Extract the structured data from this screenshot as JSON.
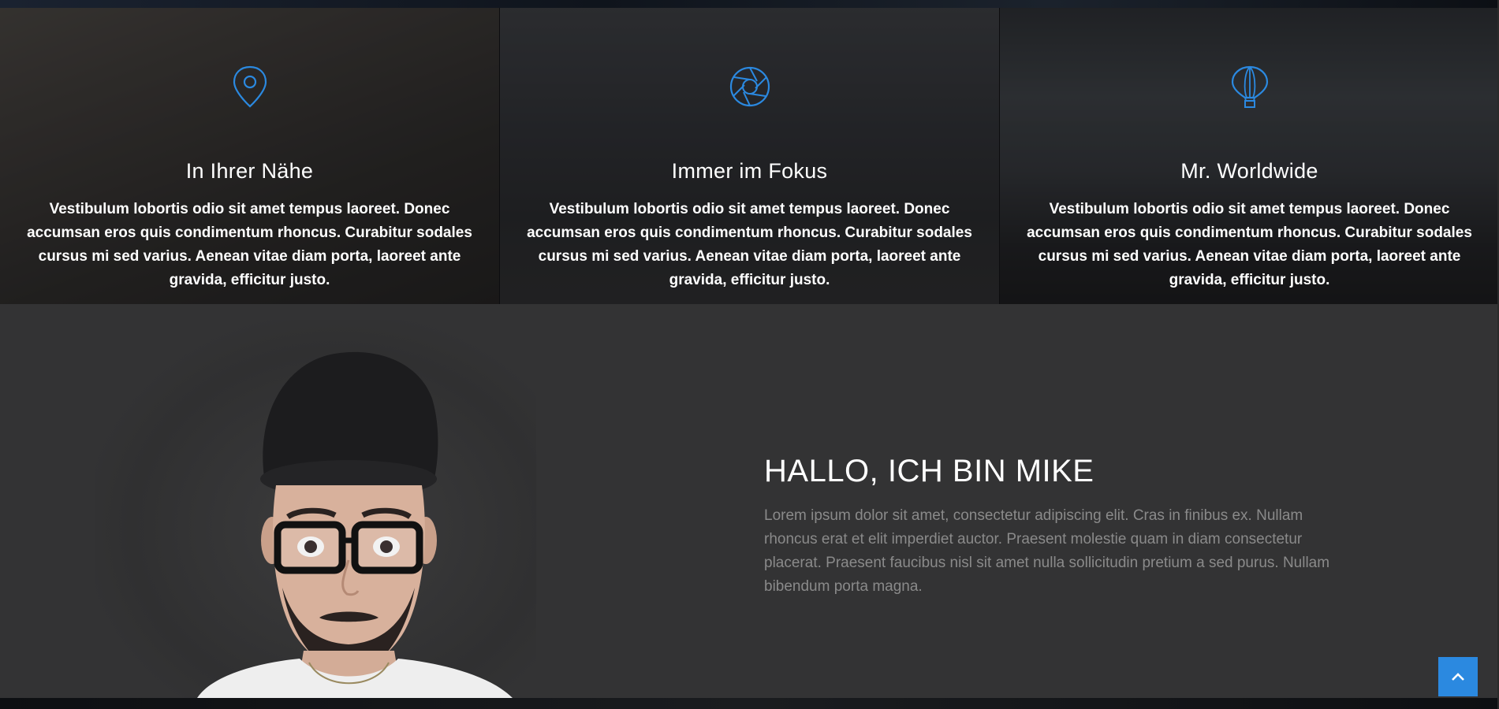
{
  "features": [
    {
      "icon": "map-pin-icon",
      "title": "In Ihrer Nähe",
      "text": "Vestibulum lobortis odio sit amet tempus laoreet. Donec accumsan eros quis condimentum rhoncus. Curabitur sodales cursus mi sed varius. Aenean vitae diam porta, laoreet ante gravida, efficitur justo."
    },
    {
      "icon": "camera-aperture-icon",
      "title": "Immer im Fokus",
      "text": "Vestibulum lobortis odio sit amet tempus laoreet. Donec accumsan eros quis condimentum rhoncus. Curabitur sodales cursus mi sed varius. Aenean vitae diam porta, laoreet ante gravida, efficitur justo."
    },
    {
      "icon": "hot-air-balloon-icon",
      "title": "Mr. Worldwide",
      "text": "Vestibulum lobortis odio sit amet tempus laoreet. Donec accumsan eros quis condimentum rhoncus. Curabitur sodales cursus mi sed varius. Aenean vitae diam porta, laoreet ante gravida, efficitur justo."
    }
  ],
  "about": {
    "title": "HALLO, ICH BIN MIKE",
    "text": "Lorem ipsum dolor sit amet, consectetur adipiscing elit. Cras in finibus ex. Nullam rhoncus erat et elit imperdiet auctor. Praesent molestie quam in diam consectetur placerat. Praesent faucibus nisl sit amet nulla sollicitudin pretium a sed purus. Nullam bibendum porta magna."
  },
  "scroll_top": {
    "icon": "chevron-up-icon"
  },
  "colors": {
    "accent": "#2b89e0",
    "section_bg": "#333334",
    "text_muted": "#8a8a8a"
  }
}
